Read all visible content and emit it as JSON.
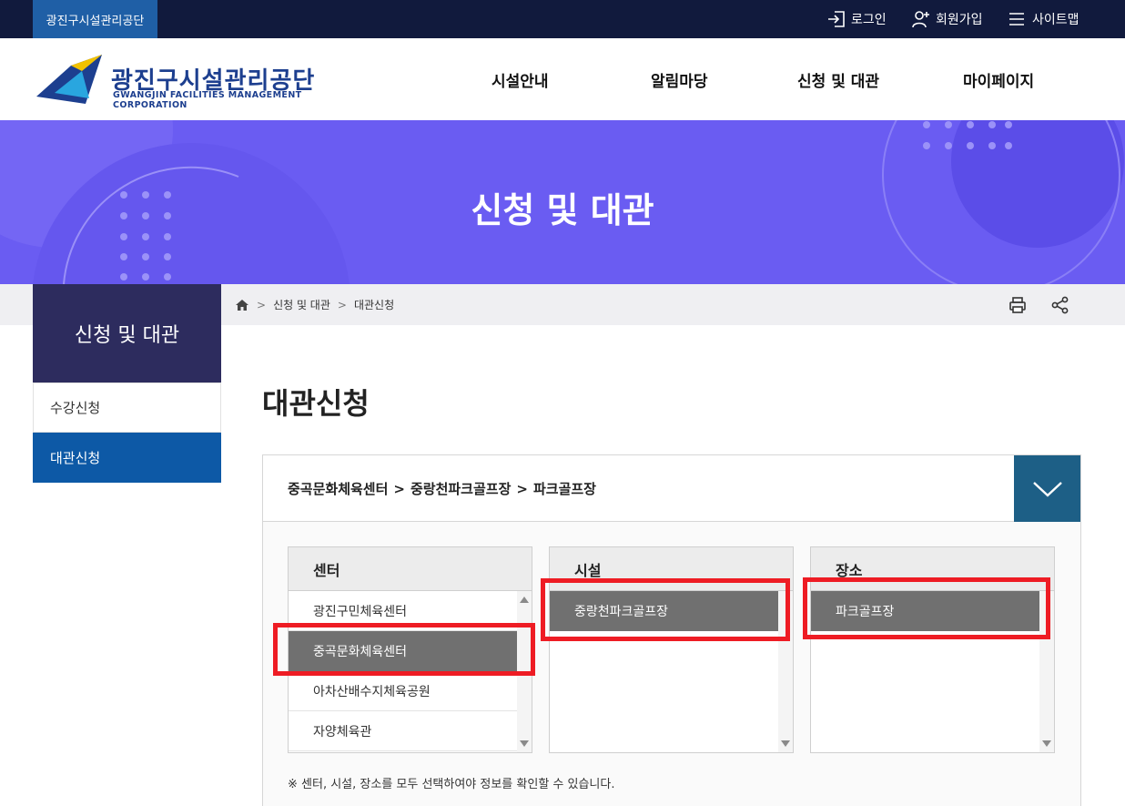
{
  "topbar": {
    "site_name": "광진구시설관리공단",
    "login": "로그인",
    "join": "회원가입",
    "sitemap": "사이트맵"
  },
  "header": {
    "logo_name": "광진구시설관리공단",
    "logo_sub": "GWANGJIN FACILITIES MANAGEMENT CORPORATION",
    "nav": [
      "시설안내",
      "알림마당",
      "신청 및 대관",
      "마이페이지"
    ]
  },
  "hero": {
    "title": "신청 및 대관"
  },
  "breadcrumb": {
    "items": [
      "신청 및 대관",
      "대관신청"
    ]
  },
  "sidebar": {
    "title": "신청 및 대관",
    "items": [
      {
        "label": "수강신청",
        "active": false
      },
      {
        "label": "대관신청",
        "active": true
      }
    ]
  },
  "main": {
    "title": "대관신청",
    "selection": {
      "center": "중곡문화체육센터",
      "sep": ">",
      "facility": "중랑천파크골프장",
      "place": "파크골프장"
    },
    "columns": {
      "center": {
        "header": "센터",
        "options": [
          "광진구민체육센터",
          "중곡문화체육센터",
          "아차산배수지체육공원",
          "자양체육관"
        ],
        "selected": "중곡문화체육센터"
      },
      "facility": {
        "header": "시설",
        "options": [
          "중랑천파크골프장"
        ],
        "selected": "중랑천파크골프장"
      },
      "place": {
        "header": "장소",
        "options": [
          "파크골프장"
        ],
        "selected": "파크골프장"
      }
    },
    "note": "※ 센터, 시설, 장소를 모두 선택하여야 정보를 확인할 수 있습니다."
  },
  "colors": {
    "topbar": "#111a3d",
    "hero": "#6a5cf2",
    "sidebar_head": "#2d2c5e",
    "sidebar_active": "#0d59a6",
    "toggle": "#1d5f86",
    "selected_option": "#707070",
    "highlight": "#ee1c24"
  }
}
